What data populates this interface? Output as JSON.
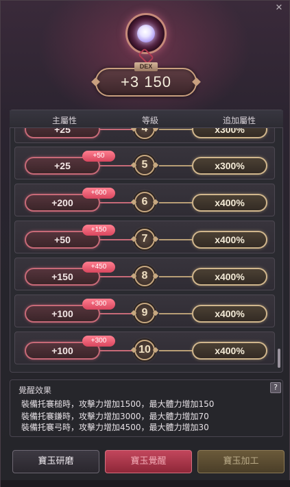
{
  "window": {
    "close_label": "✕"
  },
  "stat": {
    "tag": "DEX",
    "value": "+3 150"
  },
  "table": {
    "headers": {
      "main": "主屬性",
      "level": "等級",
      "add": "追加屬性"
    },
    "rows": [
      {
        "main": "+25",
        "bonus": "",
        "level": "4",
        "add": "x300%"
      },
      {
        "main": "+25",
        "bonus": "+50",
        "level": "5",
        "add": "x300%"
      },
      {
        "main": "+200",
        "bonus": "+600",
        "level": "6",
        "add": "x400%"
      },
      {
        "main": "+50",
        "bonus": "+150",
        "level": "7",
        "add": "x400%"
      },
      {
        "main": "+150",
        "bonus": "+450",
        "level": "8",
        "add": "x400%"
      },
      {
        "main": "+100",
        "bonus": "+300",
        "level": "9",
        "add": "x400%"
      },
      {
        "main": "+100",
        "bonus": "+300",
        "level": "10",
        "add": "x400%"
      }
    ]
  },
  "effect": {
    "title": "覺醒效果",
    "help_label": "?",
    "lines": [
      "裝備托褰槌時，攻擊力增加1500，最大體力增加150",
      "裝備托褰鎌時，攻擊力增加3000，最大體力增加70",
      "裝備托褰弓時，攻擊力增加4500，最大體力增加30"
    ]
  },
  "buttons": {
    "polish": "寶玉研磨",
    "awaken": "寶玉覺醒",
    "process": "寶玉加工"
  }
}
